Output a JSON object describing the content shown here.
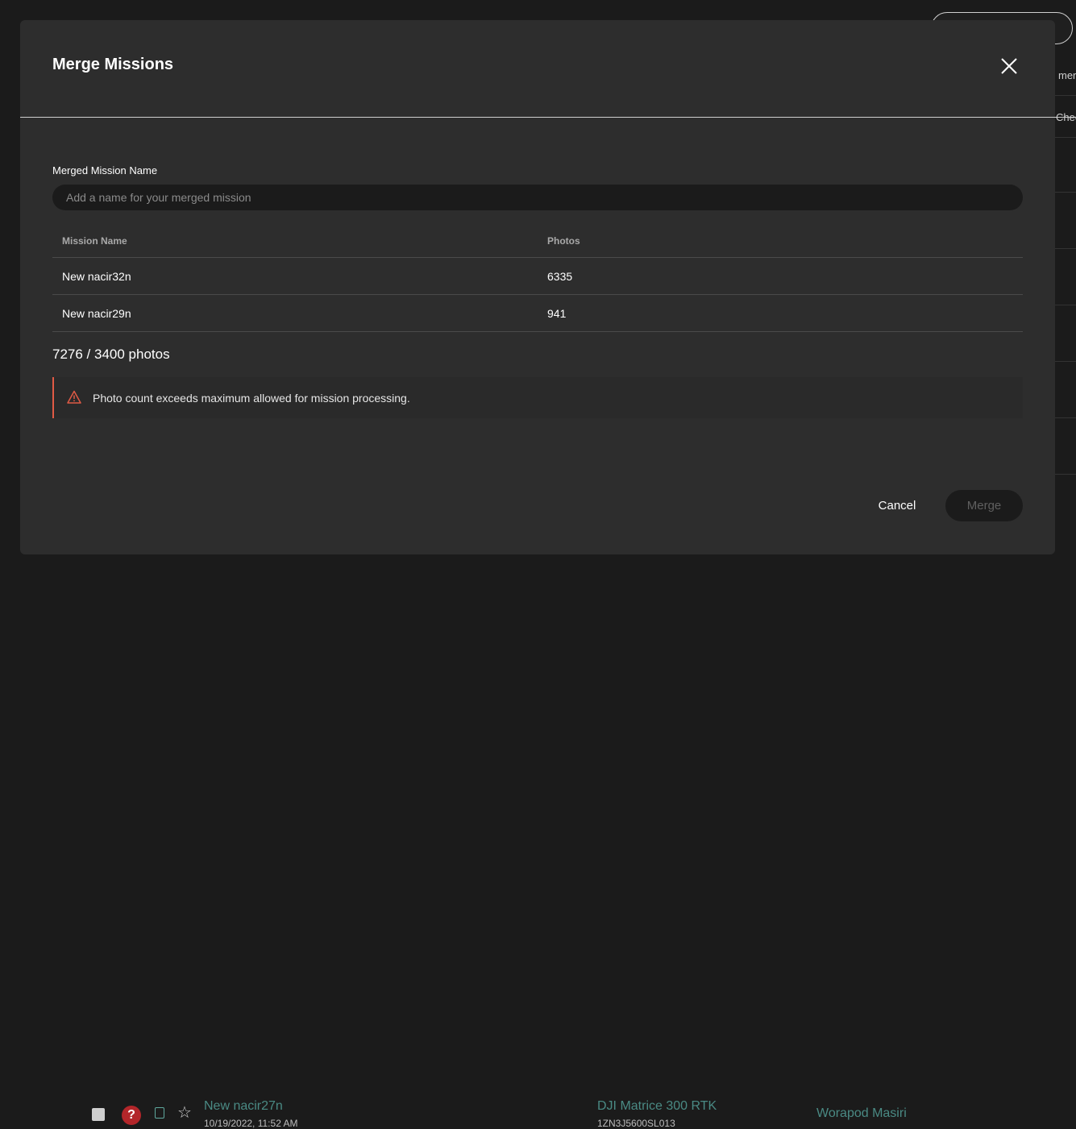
{
  "background": {
    "right_texts": [
      "mer",
      "Chec"
    ],
    "row": {
      "help_glyph": "?",
      "mission_name": "New nacir27n",
      "date": "10/19/2022, 11:52 AM",
      "drone": "DJI Matrice 300 RTK",
      "serial": "1ZN3J5600SL013",
      "owner": "Worapod Masiri"
    }
  },
  "modal": {
    "title": "Merge Missions",
    "field_label": "Merged Mission Name",
    "input_placeholder": "Add a name for your merged mission",
    "input_value": "",
    "table": {
      "headers": [
        "Mission Name",
        "Photos"
      ],
      "rows": [
        {
          "name": "New nacir32n",
          "photos": "6335"
        },
        {
          "name": "New nacir29n",
          "photos": "941"
        }
      ]
    },
    "photo_count": "7276 / 3400 photos",
    "alert_text": "Photo count exceeds maximum allowed for mission processing.",
    "cancel_label": "Cancel",
    "merge_label": "Merge"
  },
  "colors": {
    "alert_accent": "#e05a45",
    "background": "#1b1b1b",
    "modal": "#2d2d2d",
    "link": "#4a8a84"
  }
}
